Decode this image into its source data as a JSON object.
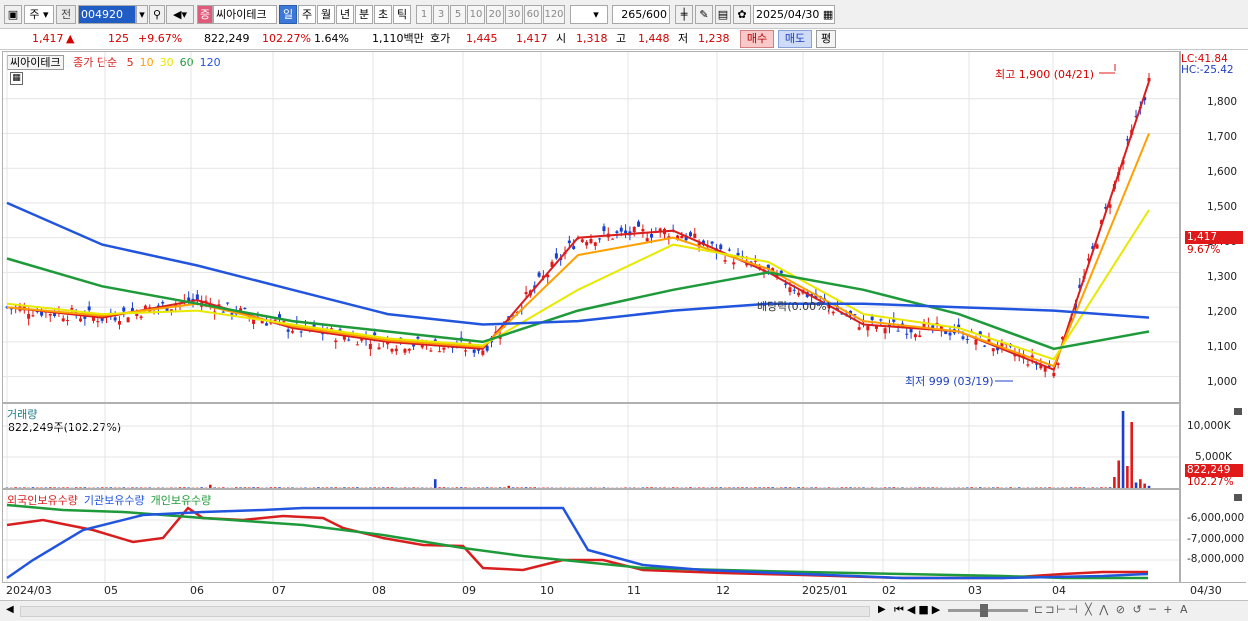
{
  "toolbar": {
    "period_select": "주",
    "prev_label": "전",
    "stock_code": "004920",
    "stock_type_badge": "증",
    "stock_name": "씨아이테크",
    "period_tabs": [
      "일",
      "주",
      "월",
      "년",
      "분",
      "초",
      "틱"
    ],
    "active_period": "일",
    "intervals": [
      "1",
      "3",
      "5",
      "10",
      "20",
      "30",
      "60",
      "120"
    ],
    "count": "265",
    "count_total": "/600",
    "date": "2025/04/30"
  },
  "quote": {
    "price": "1,417",
    "arrow": "▲",
    "change": "125",
    "change_rate": "+9.67%",
    "volume": "822,249",
    "volume_ratio": "102.27%",
    "turnover_rate": "1.64%",
    "trade_value": "1,110백만",
    "ask_label": "호가",
    "ask1": "1,445",
    "ask2": "1,417",
    "open_label": "시",
    "open": "1,318",
    "high_label": "고",
    "high": "1,448",
    "low_label": "저",
    "low": "1,238",
    "buy_button": "매수",
    "sell_button": "매도",
    "eval_button": "평"
  },
  "price_panel": {
    "name_tag": "씨아이테크",
    "ma_label": "종가 단순",
    "ma_periods": [
      "5",
      "10",
      "30",
      "60",
      "120"
    ],
    "ma_colors": [
      "#d81e1e",
      "#ffa000",
      "#e8e800",
      "#1f9a3a",
      "#2255dd"
    ],
    "lc_label": "LC:41.84",
    "hc_label": "HC:-25.42",
    "y_ticks": [
      "1,800",
      "1,700",
      "1,600",
      "1,500",
      "1,400",
      "1,300",
      "1,200",
      "1,100",
      "1,000"
    ],
    "current_price_tag": "1,417",
    "current_rate_tag": "9.67%",
    "high_note": "최고 1,900 (04/21)",
    "low_note": "최저 999 (03/19)",
    "dividend_note": "배당락(0.00%)"
  },
  "volume_panel": {
    "title": "거래량",
    "value_text": "822,249주(102.27%)",
    "y_ticks": [
      "10,000K",
      "5,000K"
    ],
    "volume_tag": "822,249",
    "ratio_tag": "102.27%"
  },
  "holdings_panel": {
    "legends": [
      "외국인보유수량",
      "기관보유수량",
      "개인보유수량"
    ],
    "legend_colors": [
      "#d81e1e",
      "#2255dd",
      "#1f9a3a"
    ],
    "y_ticks": [
      "-6,000,000",
      "-7,000,000",
      "-8,000,000"
    ]
  },
  "x_axis": [
    "2024/03",
    "05",
    "06",
    "07",
    "08",
    "09",
    "10",
    "11",
    "12",
    "2025/01",
    "02",
    "03",
    "04"
  ],
  "x_axis_right": "04/30",
  "chart_data": {
    "type": "line",
    "title": "씨아이테크 일봉",
    "y_range": [
      950,
      1900
    ],
    "x": [
      "2024/03",
      "05",
      "06",
      "07",
      "08",
      "09",
      "10",
      "11",
      "12",
      "2025/01",
      "02",
      "03",
      "04"
    ],
    "series": [
      {
        "name": "5",
        "values": [
          1200,
          1170,
          1220,
          1140,
          1100,
          1080,
          1400,
          1420,
          1300,
          1150,
          1130,
          1020,
          1850
        ]
      },
      {
        "name": "10",
        "values": [
          1200,
          1175,
          1210,
          1145,
          1105,
          1085,
          1350,
          1400,
          1310,
          1160,
          1130,
          1030,
          1700
        ]
      },
      {
        "name": "30",
        "values": [
          1210,
          1180,
          1190,
          1150,
          1110,
          1090,
          1250,
          1380,
          1330,
          1180,
          1140,
          1050,
          1480
        ]
      },
      {
        "name": "60",
        "values": [
          1340,
          1260,
          1210,
          1160,
          1130,
          1100,
          1190,
          1250,
          1300,
          1250,
          1180,
          1080,
          1130
        ]
      },
      {
        "name": "120",
        "values": [
          1500,
          1380,
          1320,
          1250,
          1180,
          1150,
          1160,
          1190,
          1210,
          1210,
          1200,
          1190,
          1170
        ]
      }
    ],
    "current_price": 1417,
    "high": 1900,
    "low": 999
  }
}
